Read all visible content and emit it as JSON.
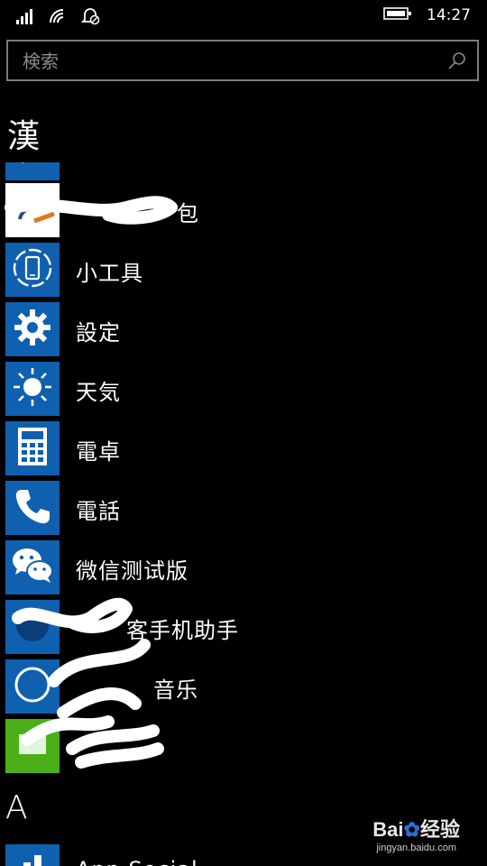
{
  "status": {
    "time": "14:27"
  },
  "search": {
    "placeholder": "検索"
  },
  "groups": [
    {
      "letter": "漢"
    },
    {
      "letter": "A"
    }
  ],
  "apps": [
    {
      "label": "",
      "icon": "pen-icon",
      "tile_color": "#1060b0"
    },
    {
      "label": "包",
      "icon": "app-icon",
      "tile_color": "#ffffff"
    },
    {
      "label": "小工具",
      "icon": "phone-device-icon",
      "tile_color": "#1060b0"
    },
    {
      "label": "設定",
      "icon": "gear-icon",
      "tile_color": "#1060b0"
    },
    {
      "label": "天気",
      "icon": "sun-icon",
      "tile_color": "#1060b0"
    },
    {
      "label": "電卓",
      "icon": "calculator-icon",
      "tile_color": "#1060b0"
    },
    {
      "label": "電話",
      "icon": "phone-icon",
      "tile_color": "#1060b0"
    },
    {
      "label": "微信测试版",
      "icon": "wechat-icon",
      "tile_color": "#1060b0"
    },
    {
      "label": "客手机助手",
      "icon": "app-icon",
      "tile_color": "#1060b0"
    },
    {
      "label": "音乐",
      "icon": "music-icon",
      "tile_color": "#1060b0"
    },
    {
      "label": "",
      "icon": "app-icon",
      "tile_color": "#4caf1a"
    },
    {
      "label": "App Social",
      "icon": "store-icon",
      "tile_color": "#1060b0"
    }
  ],
  "watermark": {
    "logo": "Bai",
    "logo_suffix": "经验",
    "url": "jingyan.baidu.com"
  }
}
